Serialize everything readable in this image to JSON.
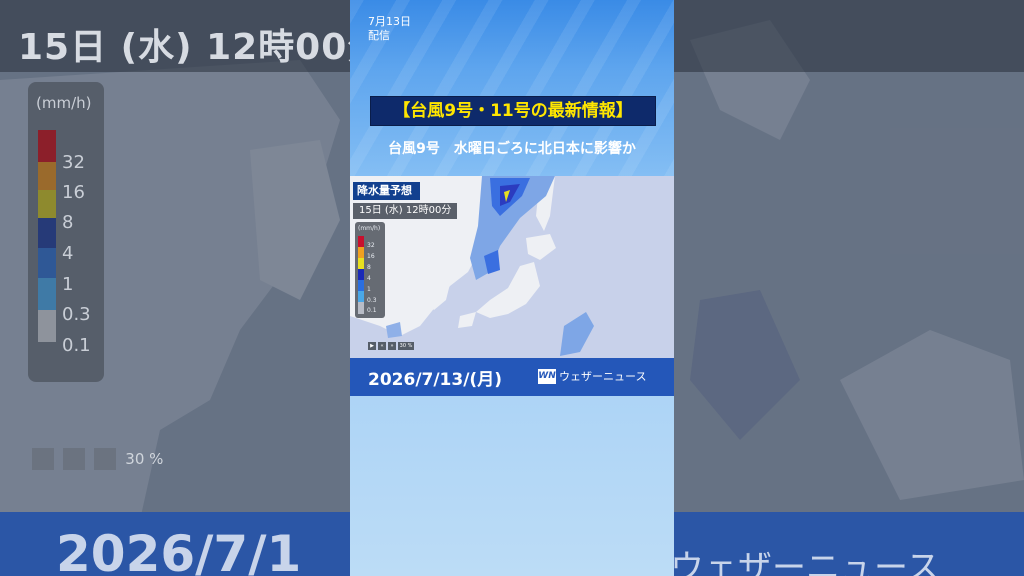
{
  "background": {
    "time_label": "15日 (水) 12時00分",
    "legend_unit": "(mm/h)",
    "legend": [
      "32",
      "16",
      "8",
      "4",
      "1",
      "0.3",
      "0.1"
    ],
    "zoom": "30 %",
    "date": "2026/7/1",
    "brand": "ウェザーニュース"
  },
  "video": {
    "published_date": "7月13日",
    "published_label": "配信",
    "title": "【台風9号・11号の最新情報】",
    "subtitle": "台風9号　水曜日ごろに北日本に影響か",
    "map": {
      "tag": "降水量予想",
      "time": "15日 (水) 12時00分",
      "legend_unit": "(mm/h)",
      "legend": [
        {
          "label": "32",
          "color": "#c8102e"
        },
        {
          "label": "16",
          "color": "#f0a020"
        },
        {
          "label": "8",
          "color": "#e8e020"
        },
        {
          "label": "4",
          "color": "#1a2ab8"
        },
        {
          "label": "1",
          "color": "#2a6ee0"
        },
        {
          "label": "0.3",
          "color": "#4aa8e8"
        },
        {
          "label": "0.1",
          "color": "#b8bcc6"
        }
      ],
      "zoom": "30 %"
    },
    "date": "2026/7/13/(月)",
    "logo": "WN",
    "brand": "ウェザーニュース"
  }
}
